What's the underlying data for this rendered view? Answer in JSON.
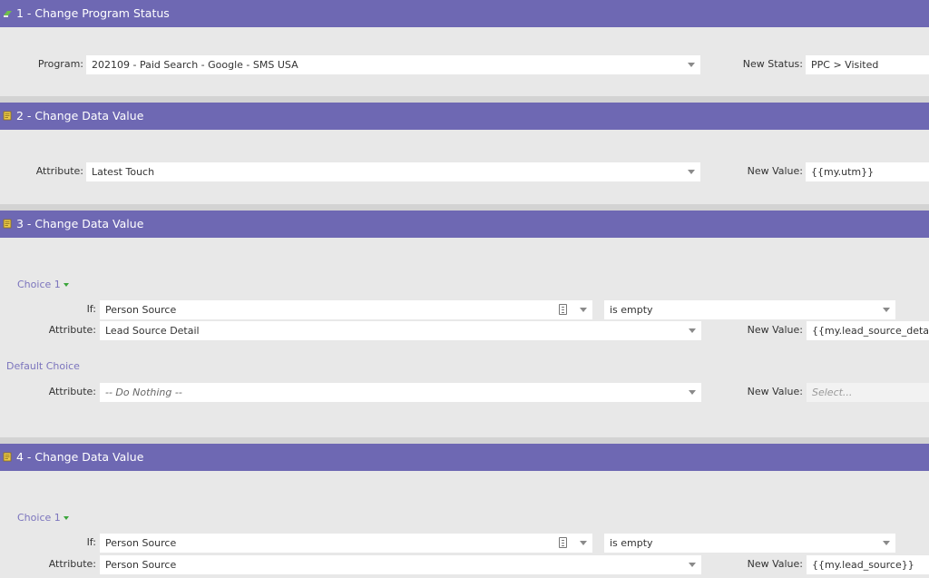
{
  "steps": [
    {
      "title": "1 - Change Program Status",
      "icon": "program-status-icon",
      "program_label": "Program:",
      "program_value": "202109 - Paid Search - Google - SMS USA",
      "status_label": "New Status:",
      "status_value": "PPC > Visited"
    },
    {
      "title": "2 - Change Data Value",
      "icon": "data-value-icon",
      "attribute_label": "Attribute:",
      "attribute_value": "Latest Touch",
      "new_value_label": "New Value:",
      "new_value": "{{my.utm}}"
    },
    {
      "title": "3 - Change Data Value",
      "icon": "data-value-icon",
      "choice_label": "Choice 1",
      "if_label": "If:",
      "if_field": "Person Source",
      "if_operator": "is empty",
      "attribute_label": "Attribute:",
      "attribute_value": "Lead Source Detail",
      "new_value_label": "New Value:",
      "new_value": "{{my.lead_source_detail}}",
      "default_choice_label": "Default Choice",
      "default_attribute_label": "Attribute:",
      "default_attribute_value": "-- Do Nothing --",
      "default_new_value_label": "New Value:",
      "default_new_value_placeholder": "Select..."
    },
    {
      "title": "4 - Change Data Value",
      "icon": "data-value-icon",
      "choice_label": "Choice 1",
      "if_label": "If:",
      "if_field": "Person Source",
      "if_operator": "is empty",
      "attribute_label": "Attribute:",
      "attribute_value": "Person Source",
      "new_value_label": "New Value:",
      "new_value": "{{my.lead_source}}"
    }
  ],
  "colors": {
    "header": "#6e68b3",
    "choice_link": "#7b74bd",
    "background": "#e8e8e8"
  }
}
